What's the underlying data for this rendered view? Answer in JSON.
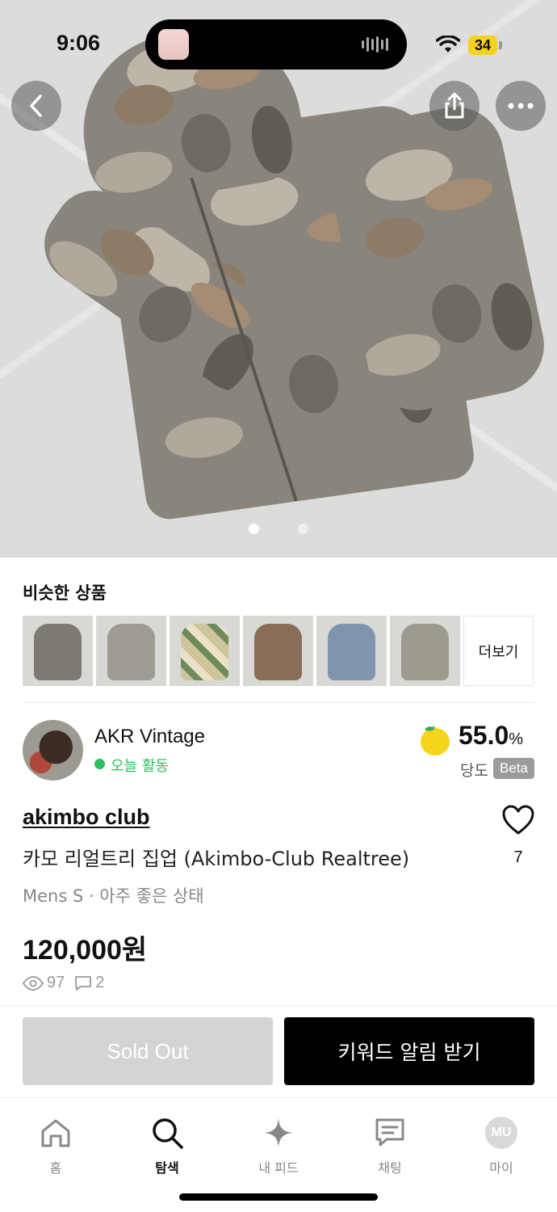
{
  "status_bar": {
    "time": "9:06",
    "battery": "34"
  },
  "hero": {
    "image_description_icon": "camo-hoodie-photo",
    "page_count": 2,
    "active_page": 1
  },
  "similar": {
    "title": "비슷한 상품",
    "more_label": "더보기",
    "item_colors": [
      "#7d7a74",
      "#9e9b92",
      "#a6a086",
      "#8a6d57",
      "#7f95ad",
      "#9d9a90"
    ]
  },
  "seller": {
    "name": "AKR Vintage",
    "activity": "오늘 활동",
    "sweetness_value": "55.0",
    "sweetness_unit": "%",
    "sweetness_label": "당도",
    "beta": "Beta"
  },
  "product": {
    "brand": "akimbo club",
    "title": "카모 리얼트리 집업 (Akimbo-Club Realtree)",
    "meta": "Mens S · 아주 좋은 상태",
    "price": "120,000원",
    "likes": "7",
    "views": "97",
    "comments": "2"
  },
  "actions": {
    "sold_out": "Sold Out",
    "keyword_alert": "키워드 알림 받기"
  },
  "tabs": [
    {
      "label": "홈",
      "icon": "home-icon"
    },
    {
      "label": "탐색",
      "icon": "search-icon"
    },
    {
      "label": "내 피드",
      "icon": "sparkle-icon"
    },
    {
      "label": "채팅",
      "icon": "chat-icon"
    },
    {
      "label": "마이",
      "icon": "profile-avatar",
      "avatar_text": "MU"
    }
  ],
  "colors": {
    "active_green": "#2bbf5d",
    "lemon": "#f5d51a"
  }
}
